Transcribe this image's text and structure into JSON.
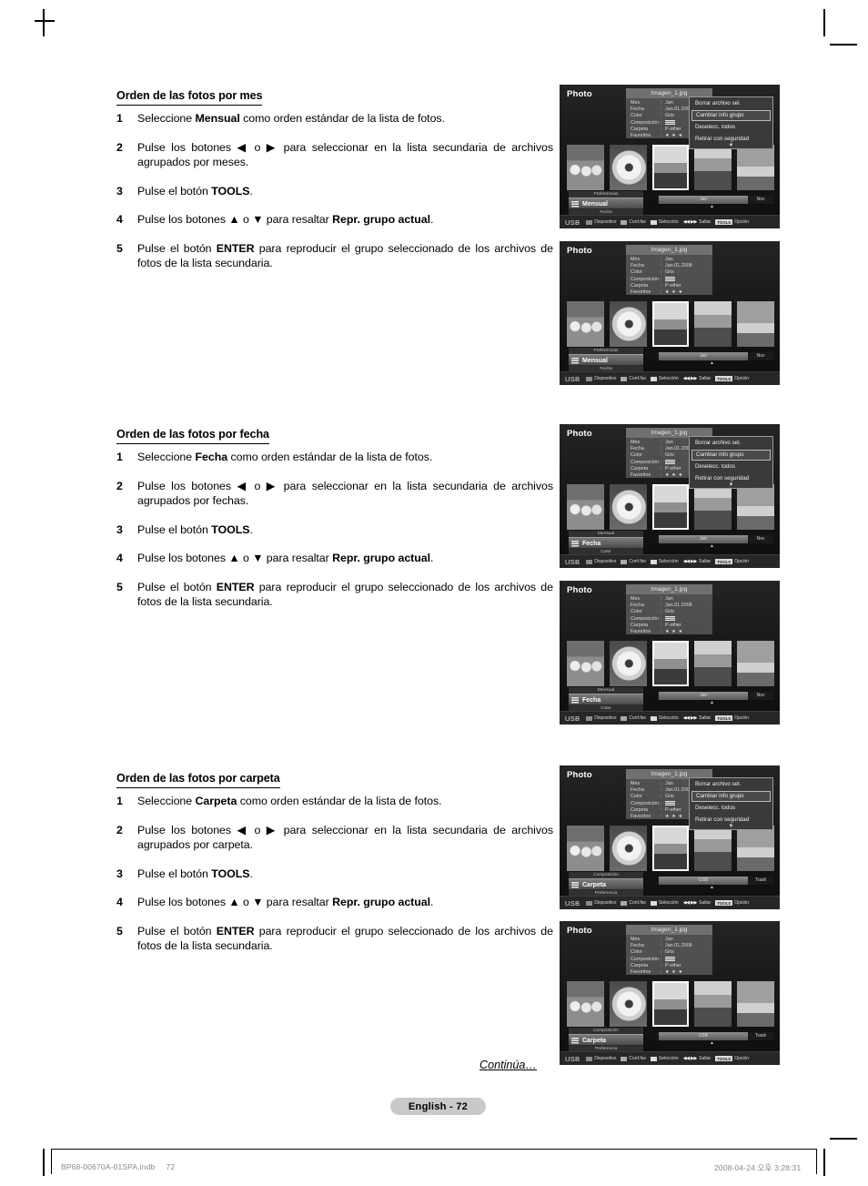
{
  "page": {
    "continued_label": "Continúa…",
    "page_badge": "English - 72",
    "footer_left_file": "BP68-00670A-01SPA.indb",
    "footer_left_page": "72",
    "footer_right": "2008-04-24   오후 3:28:31"
  },
  "sections": [
    {
      "heading": "Orden de las fotos por mes",
      "steps": [
        {
          "num": "1",
          "html": "Seleccione <b>Mensual</b> como orden estándar de la lista de fotos."
        },
        {
          "num": "2",
          "html": "Pulse los botones ◀ o ▶ para seleccionar en la lista secundaria de archivos agrupados por meses."
        },
        {
          "num": "3",
          "html": "Pulse el botón <b>TOOLS</b>."
        },
        {
          "num": "4",
          "html": "Pulse los botones ▲ o ▼ para resaltar <b>Repr. grupo actual</b>."
        },
        {
          "num": "5",
          "html": "Pulse el botón <b>ENTER</b> para reproducir el grupo seleccionado de los archivos de fotos de la lista secundaria."
        }
      ]
    },
    {
      "heading": "Orden de las fotos por fecha",
      "steps": [
        {
          "num": "1",
          "html": "Seleccione <b>Fecha</b> como orden estándar de la lista de fotos."
        },
        {
          "num": "2",
          "html": "Pulse los botones ◀ o ▶ para seleccionar en la lista secundaria de archivos agrupados por fechas."
        },
        {
          "num": "3",
          "html": "Pulse el botón <b>TOOLS</b>."
        },
        {
          "num": "4",
          "html": "Pulse los botones ▲ o ▼ para resaltar <b>Repr. grupo actual</b>."
        },
        {
          "num": "5",
          "html": "Pulse el botón <b>ENTER</b> para reproducir el grupo seleccionado de los archivos de fotos de la lista secundaria."
        }
      ]
    },
    {
      "heading": "Orden de las fotos por carpeta",
      "steps": [
        {
          "num": "1",
          "html": "Seleccione <b>Carpeta</b> como orden estándar de la lista de fotos."
        },
        {
          "num": "2",
          "html": "Pulse los botones ◀ o ▶ para seleccionar en la lista secundaria de archivos agrupados por carpeta."
        },
        {
          "num": "3",
          "html": "Pulse el botón <b>TOOLS</b>."
        },
        {
          "num": "4",
          "html": "Pulse los botones ▲ o ▼ para resaltar <b>Repr. grupo actual</b>."
        },
        {
          "num": "5",
          "html": "Pulse el botón <b>ENTER</b> para reproducir el grupo seleccionado de los archivos de fotos de la lista secundaria."
        }
      ]
    }
  ],
  "tv_common": {
    "title": "Photo",
    "filename": "Imagen_1.jpg",
    "info_rows": [
      {
        "key": "Mes",
        "value": "Jan"
      },
      {
        "key": "Fecha",
        "value": "Jan.01.2008"
      },
      {
        "key": "Color",
        "value": "Gris"
      },
      {
        "key": "Composición",
        "value": ""
      },
      {
        "key": "Carpeta",
        "value": "P-other"
      },
      {
        "key": "Favoritos",
        "value": "★ ★ ★"
      }
    ],
    "popup_items": [
      {
        "label": "Borrar archivo sel.",
        "selected": false
      },
      {
        "label": "Cambiar info grupo",
        "selected": true
      },
      {
        "label": "Deselecc. todos",
        "selected": false
      },
      {
        "label": "Retirar con seguridad",
        "selected": false
      }
    ],
    "popup_more": "▼",
    "helpbar": {
      "source": "USB",
      "items": [
        {
          "swatch": "red",
          "label": "Dispositivo"
        },
        {
          "swatch": "green",
          "label": "Conf.fav"
        },
        {
          "swatch": "yellow",
          "label": "Selección"
        }
      ],
      "arrows": "◀◀ ▶▶",
      "skip_label": "Saltar",
      "tools_key": "TOOLS",
      "option_label": "Opción"
    }
  },
  "tv_panels": [
    {
      "id": "panel-1-mes-tools",
      "popup_visible": true,
      "sort": {
        "prev": "Preferencias",
        "current": "Mensual",
        "next": "Fecha"
      },
      "group_nav": {
        "current": "Jan",
        "end": "Nov"
      }
    },
    {
      "id": "panel-2-mes-playing",
      "popup_visible": false,
      "sort": {
        "prev": "Preferencias",
        "current": "Mensual",
        "next": "Fecha"
      },
      "group_nav": {
        "current": "Jan",
        "end": "Nov"
      }
    },
    {
      "id": "panel-3-fecha-tools",
      "popup_visible": true,
      "sort": {
        "prev": "Mensual",
        "current": "Fecha",
        "next": "Color"
      },
      "group_nav": {
        "current": "Jan",
        "end": "Nov"
      }
    },
    {
      "id": "panel-4-fecha-playing",
      "popup_visible": false,
      "sort": {
        "prev": "Mensual",
        "current": "Fecha",
        "next": "Color"
      },
      "group_nav": {
        "current": "Jan",
        "end": "Nov"
      }
    },
    {
      "id": "panel-5-carpeta-tools",
      "popup_visible": true,
      "sort": {
        "prev": "Composición",
        "current": "Carpeta",
        "next": "Preferencia"
      },
      "group_nav": {
        "current": "USB",
        "end": "Trash"
      }
    },
    {
      "id": "panel-6-carpeta-playing",
      "popup_visible": false,
      "sort": {
        "prev": "Composición",
        "current": "Carpeta",
        "next": "Preferencia"
      },
      "group_nav": {
        "current": "USB",
        "end": "Trash"
      }
    }
  ]
}
